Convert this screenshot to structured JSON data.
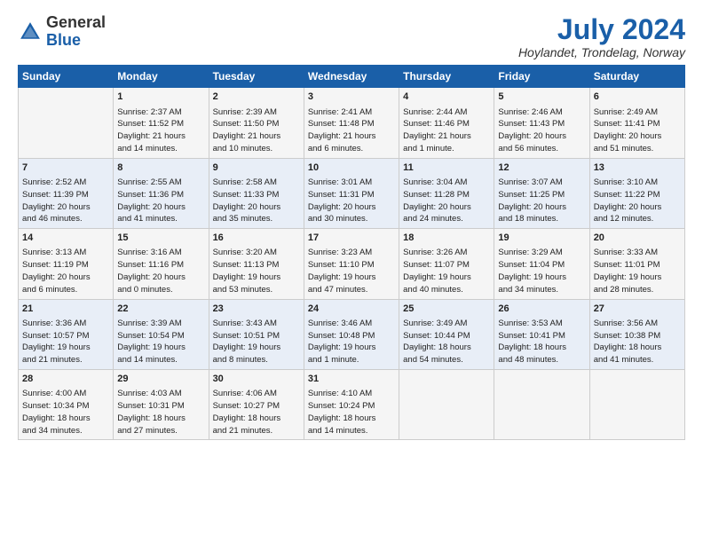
{
  "header": {
    "logo_general": "General",
    "logo_blue": "Blue",
    "month_year": "July 2024",
    "location": "Hoylandet, Trondelag, Norway"
  },
  "days_of_week": [
    "Sunday",
    "Monday",
    "Tuesday",
    "Wednesday",
    "Thursday",
    "Friday",
    "Saturday"
  ],
  "weeks": [
    [
      {
        "num": "",
        "info": ""
      },
      {
        "num": "1",
        "info": "Sunrise: 2:37 AM\nSunset: 11:52 PM\nDaylight: 21 hours\nand 14 minutes."
      },
      {
        "num": "2",
        "info": "Sunrise: 2:39 AM\nSunset: 11:50 PM\nDaylight: 21 hours\nand 10 minutes."
      },
      {
        "num": "3",
        "info": "Sunrise: 2:41 AM\nSunset: 11:48 PM\nDaylight: 21 hours\nand 6 minutes."
      },
      {
        "num": "4",
        "info": "Sunrise: 2:44 AM\nSunset: 11:46 PM\nDaylight: 21 hours\nand 1 minute."
      },
      {
        "num": "5",
        "info": "Sunrise: 2:46 AM\nSunset: 11:43 PM\nDaylight: 20 hours\nand 56 minutes."
      },
      {
        "num": "6",
        "info": "Sunrise: 2:49 AM\nSunset: 11:41 PM\nDaylight: 20 hours\nand 51 minutes."
      }
    ],
    [
      {
        "num": "7",
        "info": "Sunrise: 2:52 AM\nSunset: 11:39 PM\nDaylight: 20 hours\nand 46 minutes."
      },
      {
        "num": "8",
        "info": "Sunrise: 2:55 AM\nSunset: 11:36 PM\nDaylight: 20 hours\nand 41 minutes."
      },
      {
        "num": "9",
        "info": "Sunrise: 2:58 AM\nSunset: 11:33 PM\nDaylight: 20 hours\nand 35 minutes."
      },
      {
        "num": "10",
        "info": "Sunrise: 3:01 AM\nSunset: 11:31 PM\nDaylight: 20 hours\nand 30 minutes."
      },
      {
        "num": "11",
        "info": "Sunrise: 3:04 AM\nSunset: 11:28 PM\nDaylight: 20 hours\nand 24 minutes."
      },
      {
        "num": "12",
        "info": "Sunrise: 3:07 AM\nSunset: 11:25 PM\nDaylight: 20 hours\nand 18 minutes."
      },
      {
        "num": "13",
        "info": "Sunrise: 3:10 AM\nSunset: 11:22 PM\nDaylight: 20 hours\nand 12 minutes."
      }
    ],
    [
      {
        "num": "14",
        "info": "Sunrise: 3:13 AM\nSunset: 11:19 PM\nDaylight: 20 hours\nand 6 minutes."
      },
      {
        "num": "15",
        "info": "Sunrise: 3:16 AM\nSunset: 11:16 PM\nDaylight: 20 hours\nand 0 minutes."
      },
      {
        "num": "16",
        "info": "Sunrise: 3:20 AM\nSunset: 11:13 PM\nDaylight: 19 hours\nand 53 minutes."
      },
      {
        "num": "17",
        "info": "Sunrise: 3:23 AM\nSunset: 11:10 PM\nDaylight: 19 hours\nand 47 minutes."
      },
      {
        "num": "18",
        "info": "Sunrise: 3:26 AM\nSunset: 11:07 PM\nDaylight: 19 hours\nand 40 minutes."
      },
      {
        "num": "19",
        "info": "Sunrise: 3:29 AM\nSunset: 11:04 PM\nDaylight: 19 hours\nand 34 minutes."
      },
      {
        "num": "20",
        "info": "Sunrise: 3:33 AM\nSunset: 11:01 PM\nDaylight: 19 hours\nand 28 minutes."
      }
    ],
    [
      {
        "num": "21",
        "info": "Sunrise: 3:36 AM\nSunset: 10:57 PM\nDaylight: 19 hours\nand 21 minutes."
      },
      {
        "num": "22",
        "info": "Sunrise: 3:39 AM\nSunset: 10:54 PM\nDaylight: 19 hours\nand 14 minutes."
      },
      {
        "num": "23",
        "info": "Sunrise: 3:43 AM\nSunset: 10:51 PM\nDaylight: 19 hours\nand 8 minutes."
      },
      {
        "num": "24",
        "info": "Sunrise: 3:46 AM\nSunset: 10:48 PM\nDaylight: 19 hours\nand 1 minute."
      },
      {
        "num": "25",
        "info": "Sunrise: 3:49 AM\nSunset: 10:44 PM\nDaylight: 18 hours\nand 54 minutes."
      },
      {
        "num": "26",
        "info": "Sunrise: 3:53 AM\nSunset: 10:41 PM\nDaylight: 18 hours\nand 48 minutes."
      },
      {
        "num": "27",
        "info": "Sunrise: 3:56 AM\nSunset: 10:38 PM\nDaylight: 18 hours\nand 41 minutes."
      }
    ],
    [
      {
        "num": "28",
        "info": "Sunrise: 4:00 AM\nSunset: 10:34 PM\nDaylight: 18 hours\nand 34 minutes."
      },
      {
        "num": "29",
        "info": "Sunrise: 4:03 AM\nSunset: 10:31 PM\nDaylight: 18 hours\nand 27 minutes."
      },
      {
        "num": "30",
        "info": "Sunrise: 4:06 AM\nSunset: 10:27 PM\nDaylight: 18 hours\nand 21 minutes."
      },
      {
        "num": "31",
        "info": "Sunrise: 4:10 AM\nSunset: 10:24 PM\nDaylight: 18 hours\nand 14 minutes."
      },
      {
        "num": "",
        "info": ""
      },
      {
        "num": "",
        "info": ""
      },
      {
        "num": "",
        "info": ""
      }
    ]
  ]
}
